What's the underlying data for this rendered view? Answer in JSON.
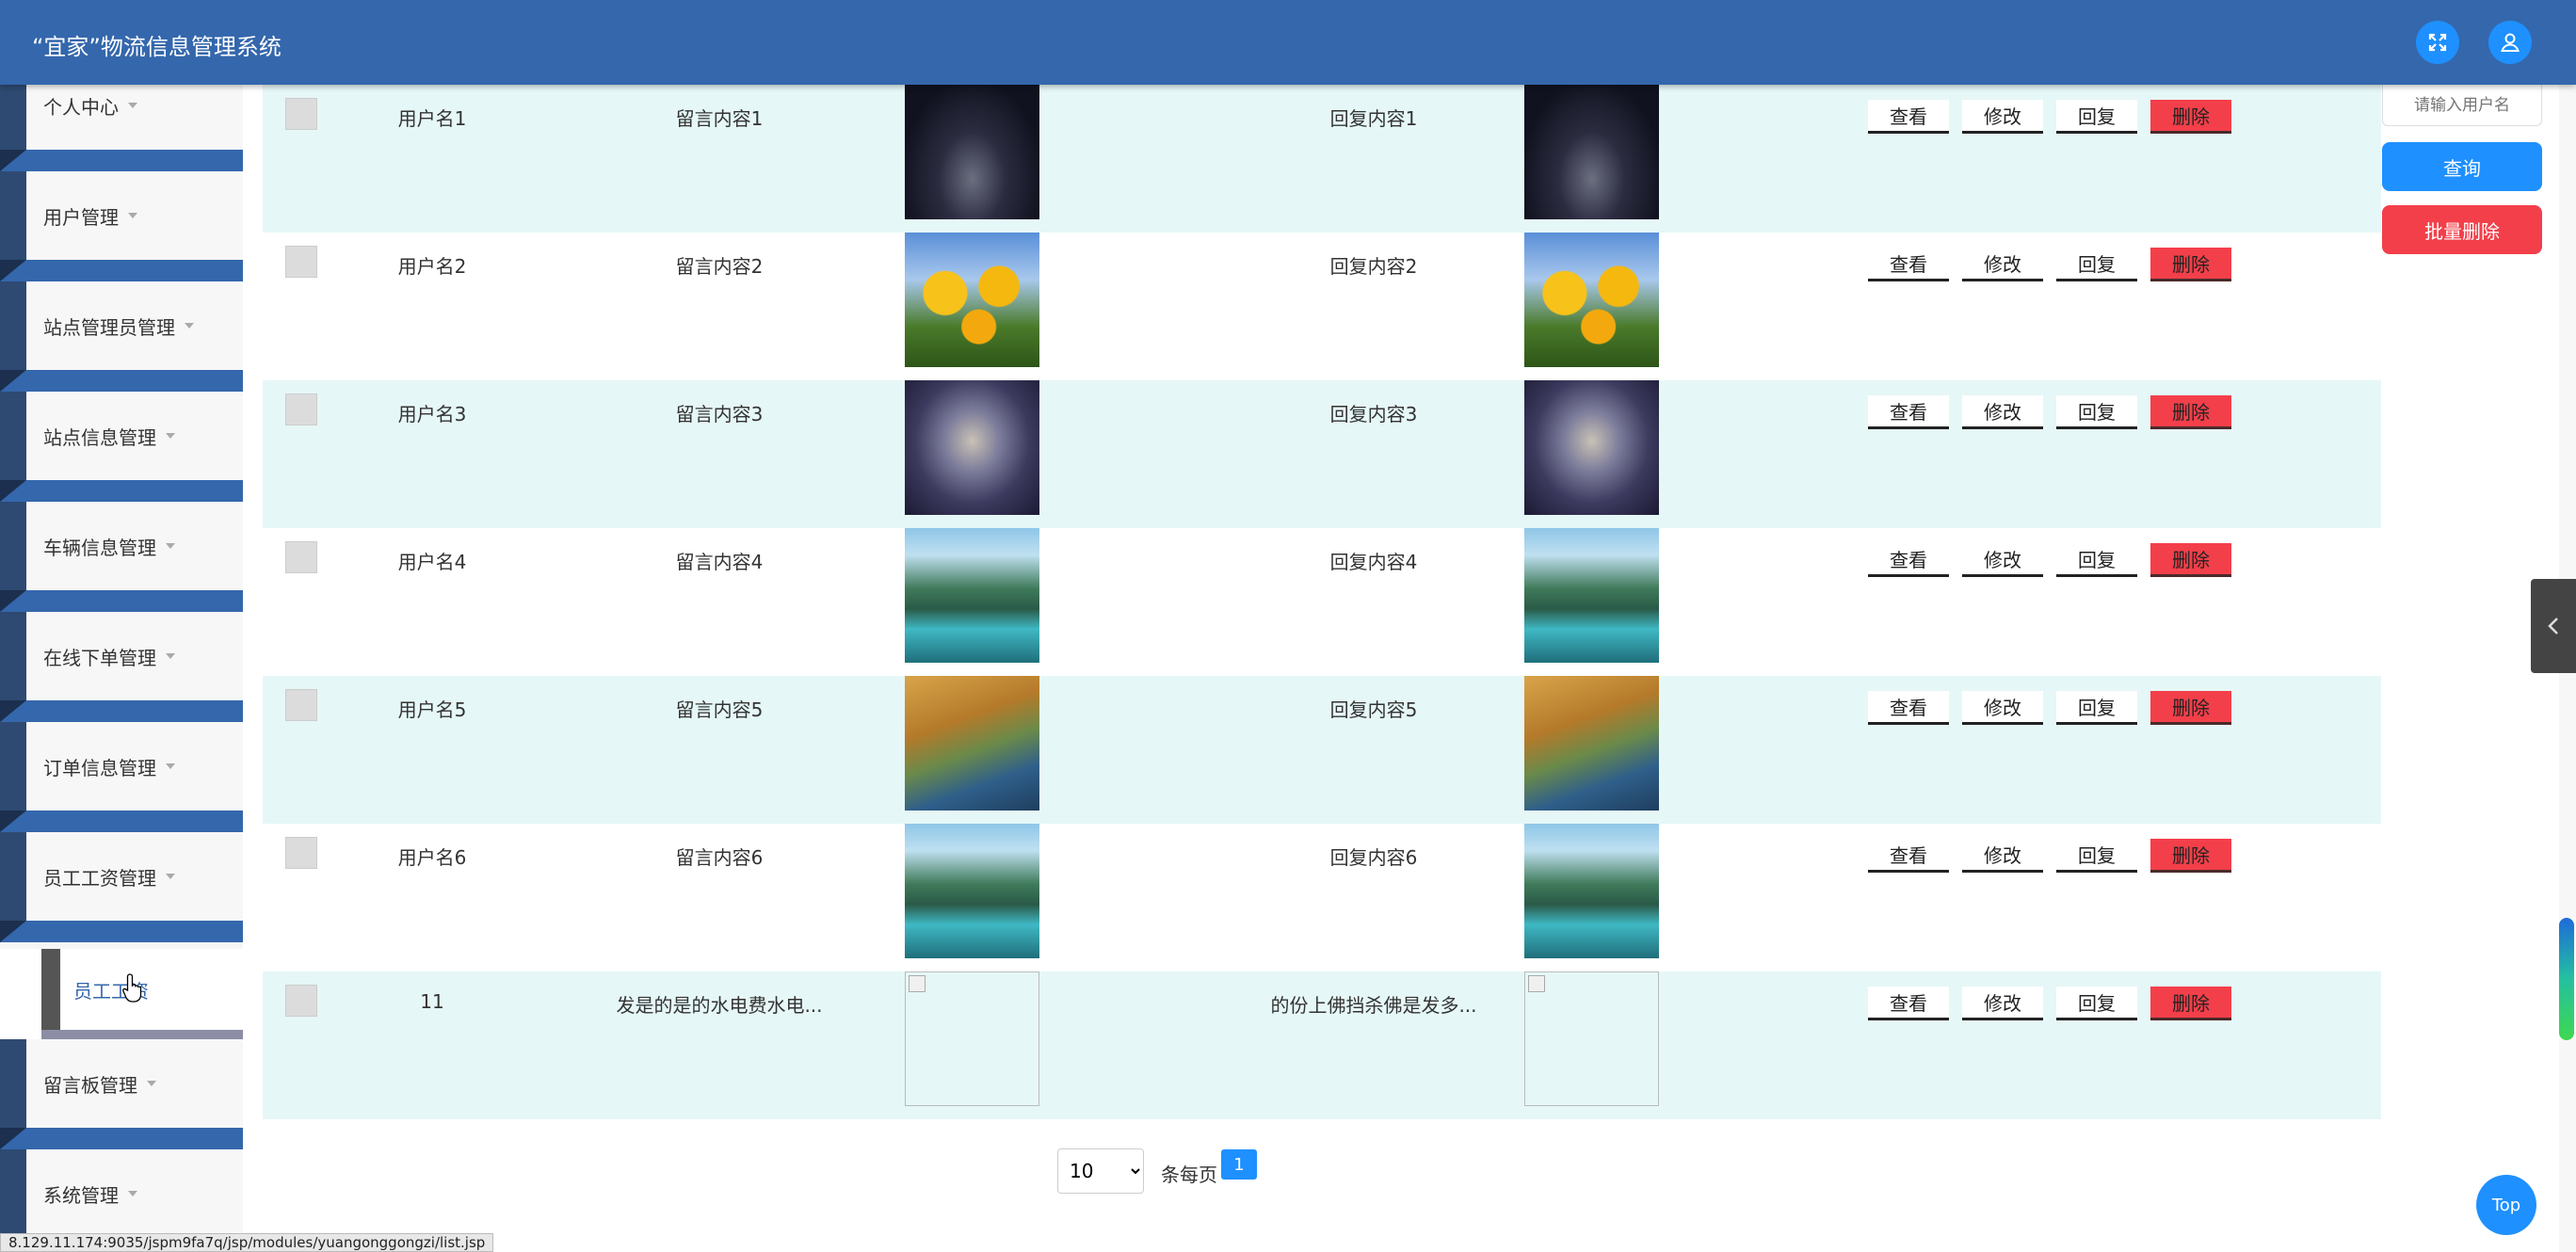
{
  "header": {
    "title": "“宜家”物流信息管理系统",
    "fullscreen_icon": "expand-icon",
    "user_icon": "user-icon"
  },
  "sidebar": {
    "items": [
      {
        "label": "个人中心"
      },
      {
        "label": "用户管理"
      },
      {
        "label": "站点管理员管理"
      },
      {
        "label": "站点信息管理"
      },
      {
        "label": "车辆信息管理"
      },
      {
        "label": "在线下单管理"
      },
      {
        "label": "订单信息管理"
      },
      {
        "label": "员工工资管理"
      },
      {
        "label": "留言板管理"
      },
      {
        "label": "系统管理"
      }
    ],
    "sub_item": {
      "label": "员工工资"
    }
  },
  "search": {
    "placeholder": "请输入用户名",
    "query_label": "查询",
    "bulk_delete_label": "批量删除"
  },
  "table": {
    "rows": [
      {
        "user": "用户名1",
        "message": "留言内容1",
        "reply": "回复内容1",
        "image": "night-sky-photo"
      },
      {
        "user": "用户名2",
        "message": "留言内容2",
        "reply": "回复内容2",
        "image": "sunflowers-photo"
      },
      {
        "user": "用户名3",
        "message": "留言内容3",
        "reply": "回复内容3",
        "image": "misty-castle-photo"
      },
      {
        "user": "用户名4",
        "message": "留言内容4",
        "reply": "回复内容4",
        "image": "mountain-lake-photo"
      },
      {
        "user": "用户名5",
        "message": "留言内容5",
        "reply": "回复内容5",
        "image": "autumn-road-photo"
      },
      {
        "user": "用户名6",
        "message": "留言内容6",
        "reply": "回复内容6",
        "image": "mountain-lake-photo"
      },
      {
        "user": "11",
        "message": "发是的是的水电费水电...",
        "reply": "的份上佛挡杀佛是发多...",
        "image": "broken-image"
      }
    ],
    "actions": {
      "view": "查看",
      "edit": "修改",
      "reply": "回复",
      "delete": "删除"
    }
  },
  "pagination": {
    "page_size": "10",
    "page_size_options": [
      "10"
    ],
    "per_page_label": "条每页",
    "current_page": "1"
  },
  "top_button": "Top",
  "status_url": "8.129.11.174:9035/jspm9fa7q/jsp/modules/yuangonggongzi/list.jsp",
  "colors": {
    "header": "#3467ac",
    "primary": "#1e90ff",
    "danger": "#f33f4a",
    "row_alt": "#e6f7f7"
  }
}
